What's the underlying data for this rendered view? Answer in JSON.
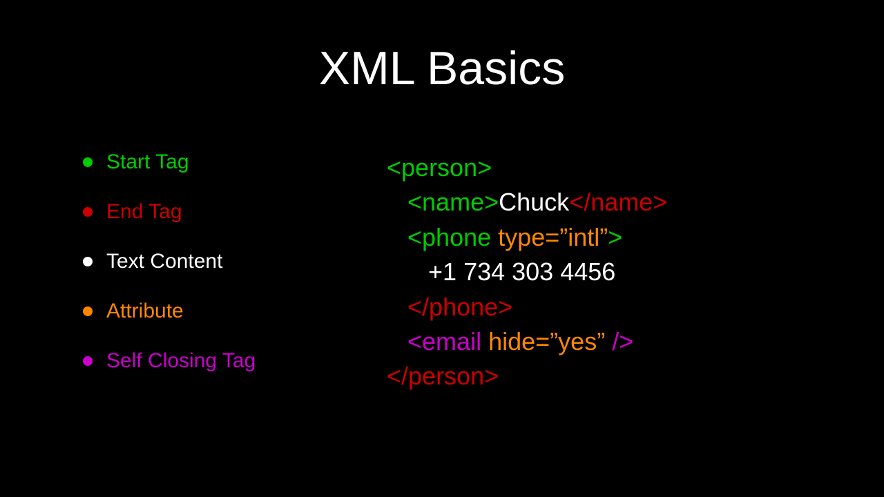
{
  "title": "XML Basics",
  "bullets": [
    {
      "label": "Start Tag",
      "colorClass": "green",
      "bulletClass": "green-bullet"
    },
    {
      "label": "End Tag",
      "colorClass": "red",
      "bulletClass": "red-bullet"
    },
    {
      "label": "Text Content",
      "colorClass": "white",
      "bulletClass": "white-bullet"
    },
    {
      "label": "Attribute",
      "colorClass": "orange",
      "bulletClass": "orange-bullet"
    },
    {
      "label": "Self Closing Tag",
      "colorClass": "magenta",
      "bulletClass": "magenta-bullet"
    }
  ],
  "code": {
    "line1": {
      "person_open": "<person>"
    },
    "line2": {
      "indent": "   ",
      "name_open": "<name>",
      "text": "Chuck",
      "name_close": "</name>"
    },
    "line3": {
      "indent": "   ",
      "phone_open": "<phone",
      "space": " ",
      "attr": "type=”intl”",
      "close": ">"
    },
    "line4": {
      "indent": "      ",
      "text": "+1 734 303 4456"
    },
    "line5": {
      "indent": "   ",
      "phone_close": "</phone>"
    },
    "line6": {
      "indent": "   ",
      "email_tag": "<email",
      "space": " ",
      "attr": "hide=”yes”",
      "selfclose": " />"
    },
    "line7": {
      "person_close": "</person>"
    }
  }
}
